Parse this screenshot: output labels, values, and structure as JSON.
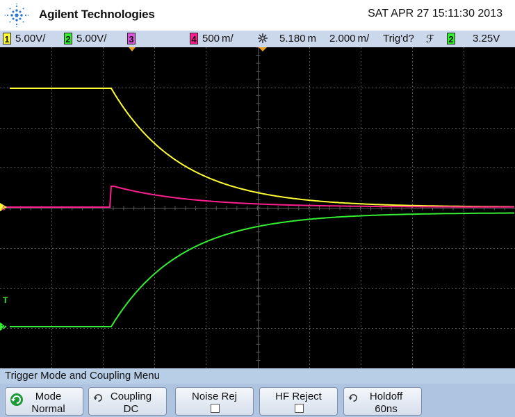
{
  "header": {
    "brand": "Agilent Technologies",
    "datetime": "SAT APR 27 15:11:30 2013"
  },
  "status": {
    "ch1_num": "1",
    "ch1_scale": "5.00V/",
    "ch2_num": "2",
    "ch2_scale": "5.00V/",
    "ch3_num": "3",
    "ch4_num": "4",
    "ch4_scale": "500 m/",
    "delay": "5.180 m",
    "timebase": "2.000 m/",
    "trig_status": "Trig'd?",
    "trig_slope": "ℱ",
    "trig_src": "2",
    "trig_level": "3.25V"
  },
  "colors": {
    "ch1": "#ffff33",
    "ch2": "#33ee33",
    "ch3": "#dd55dd",
    "ch4": "#ff1f8f",
    "grid": "#5a5a5a",
    "status_bg": "#cbd7ea"
  },
  "screen_markers": {
    "ch1_marker": "1",
    "ch4_marker": "4",
    "ch2_marker": "2",
    "trig_marker": "T"
  },
  "menu": {
    "title": "Trigger Mode and Coupling Menu",
    "softkeys": [
      {
        "label": "Mode",
        "value": "Normal"
      },
      {
        "label": "Coupling",
        "value": "DC"
      },
      {
        "label": "Noise Rej",
        "value": ""
      },
      {
        "label": "HF Reject",
        "value": ""
      },
      {
        "label": "Holdoff",
        "value": "60ns"
      }
    ]
  },
  "icons": {
    "logo": "agilent-spark-icon",
    "rotate": "entry-knob-icon",
    "delay": "delay-icon"
  }
}
